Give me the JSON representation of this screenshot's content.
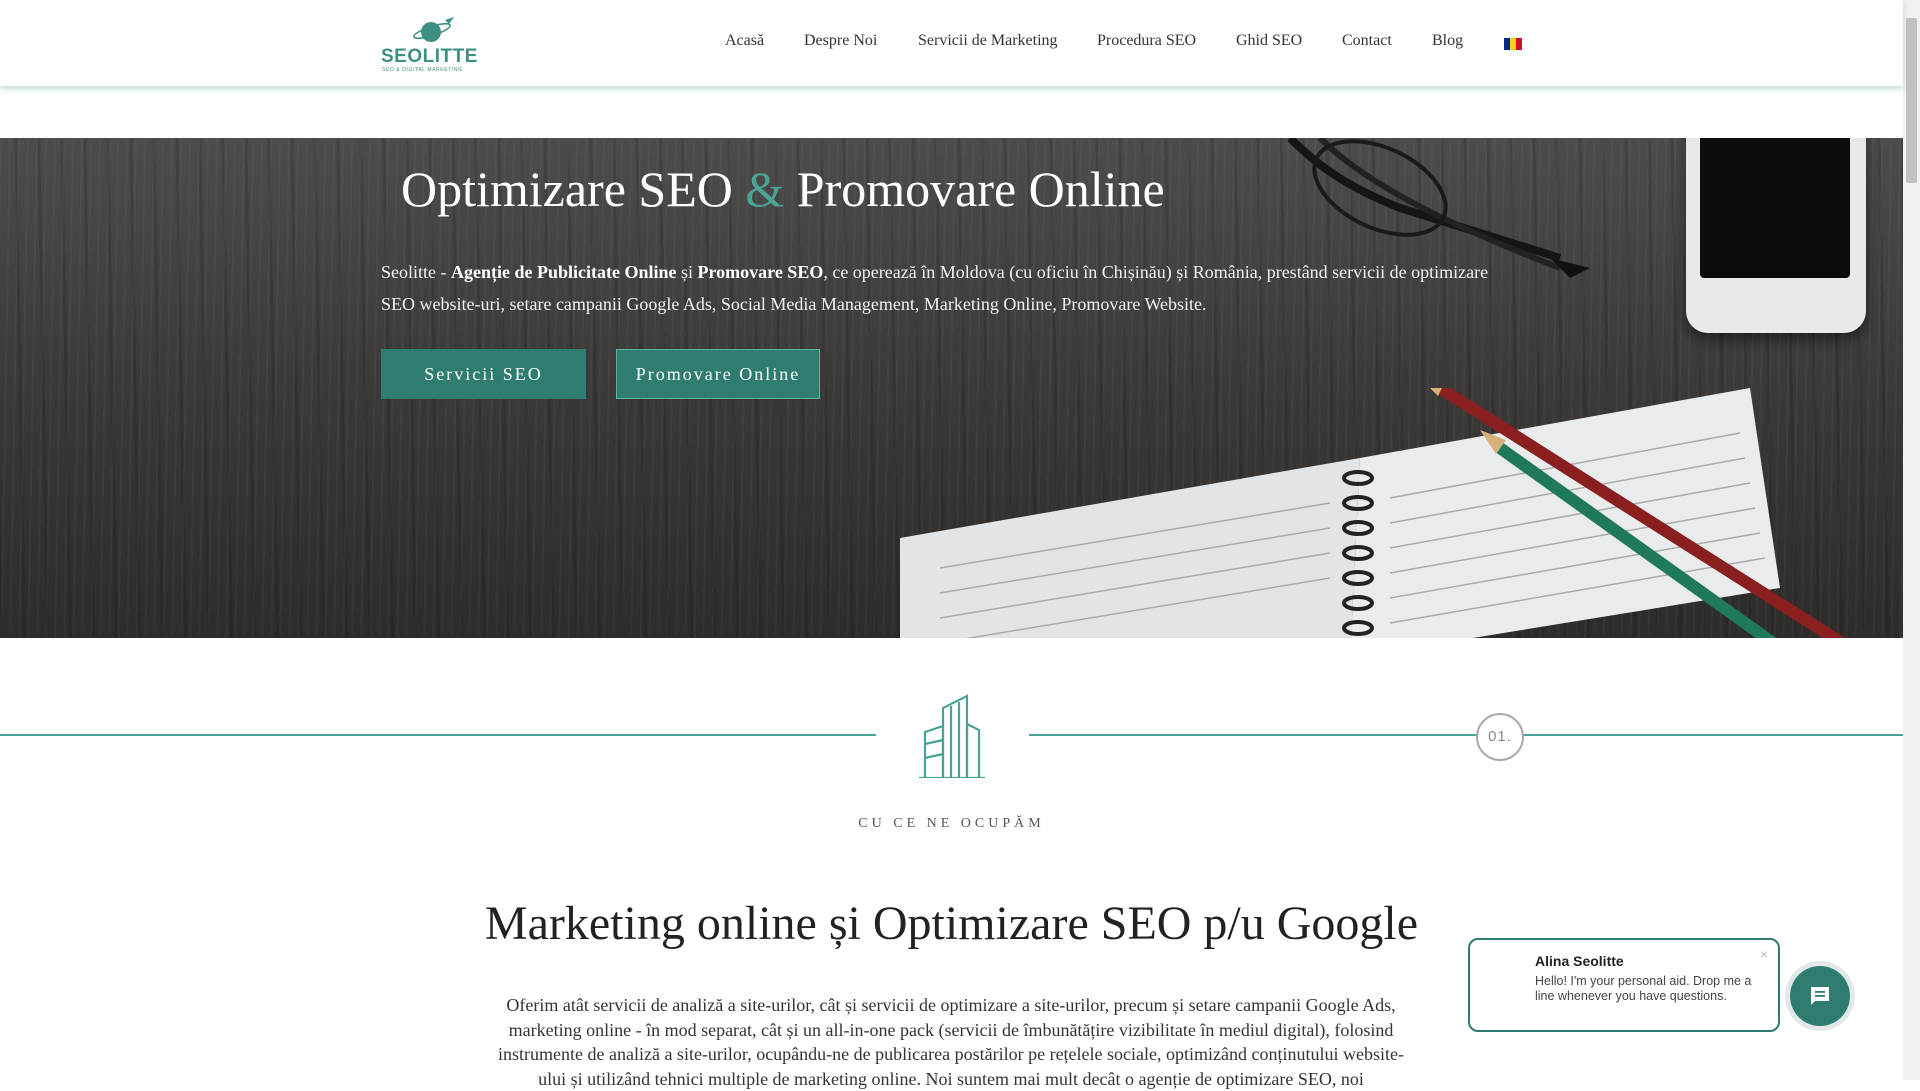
{
  "header": {
    "logo": {
      "brand": "SEOLITTE",
      "tagline": "SEO & DIGITAL MARKETING",
      "icon": "planet-logo-icon"
    },
    "nav": [
      {
        "label": "Acasă"
      },
      {
        "label": "Despre Noi"
      },
      {
        "label": "Servicii de Marketing"
      },
      {
        "label": "Procedura SEO"
      },
      {
        "label": "Ghid SEO"
      },
      {
        "label": "Contact"
      },
      {
        "label": "Blog"
      }
    ],
    "language_flag": {
      "icon": "romania-flag-icon",
      "colors": [
        "#002B7F",
        "#FCD116",
        "#CE1126"
      ]
    }
  },
  "hero": {
    "title_part1": "Optimizare SEO",
    "title_amp": "&",
    "title_part2": "Promovare Online",
    "text": {
      "p1": "Seolitte - ",
      "b1": "Agenție de Publicitate Online",
      "p2": " și ",
      "b2": "Promovare SEO",
      "p3": ", ce operează în Moldova (cu oficiu în Chișinău) și România, prestând servicii de optimizare SEO website-uri, setare campanii Google Ads, Social Media Management, Marketing Online, Promovare Website."
    },
    "buttons": {
      "seo": "Servicii SEO",
      "promo": "Promovare Online"
    }
  },
  "section": {
    "icon": "building-icon",
    "number": "01.",
    "label": "CU CE NE OCUPĂM",
    "title": "Marketing online și Optimizare SEO p/u Google",
    "text": "Oferim atât servicii de analiză a site-urilor, cât și servicii de optimizare a site-urilor, precum și setare campanii Google Ads, marketing online - în mod separat, cât și un all-in-one pack (servicii de îmbunătățire vizibilitate în mediul digital), folosind instrumente de analiză a site-urilor, ocupându-ne de publicarea postărilor pe rețelele sociale, optimizând conținutului website-ului și utilizând tehnici multiple de marketing online. Noi suntem mai mult decât o agenție de optimizare SEO, noi"
  },
  "chat": {
    "name": "Alina Seolitte",
    "message": "Hello! I'm your personal aid. Drop me a line whenever you have questions.",
    "close": "×",
    "button_icon": "chat-icon"
  },
  "colors": {
    "accent": "#4aa495",
    "button": "#2f7d70"
  }
}
